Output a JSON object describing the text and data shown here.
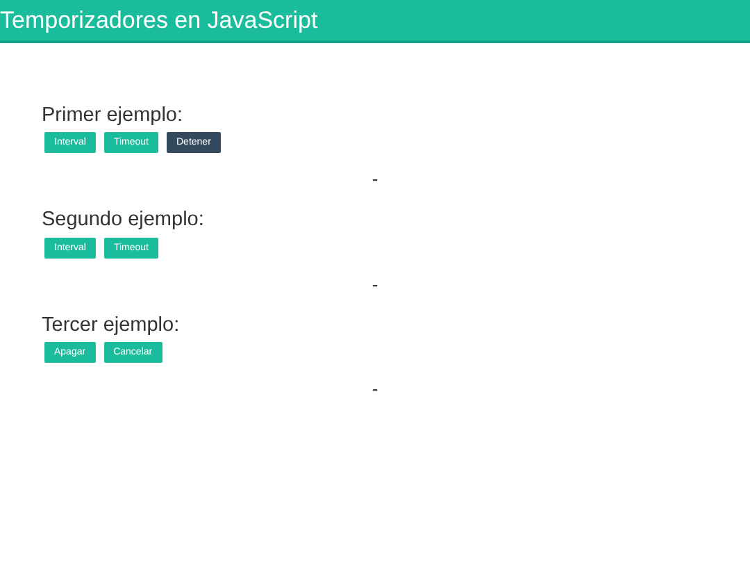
{
  "header": {
    "title": "Temporizadores en JavaScript"
  },
  "sections": [
    {
      "heading": "Primer ejemplo:",
      "buttons": [
        {
          "label": "Interval",
          "kind": "primary"
        },
        {
          "label": "Timeout",
          "kind": "primary"
        },
        {
          "label": "Detener",
          "kind": "dark"
        }
      ],
      "output": "-"
    },
    {
      "heading": "Segundo ejemplo:",
      "buttons": [
        {
          "label": "Interval",
          "kind": "primary"
        },
        {
          "label": "Timeout",
          "kind": "primary"
        }
      ],
      "output": "-"
    },
    {
      "heading": "Tercer ejemplo:",
      "buttons": [
        {
          "label": "Apagar",
          "kind": "primary"
        },
        {
          "label": "Cancelar",
          "kind": "primary"
        }
      ],
      "output": "-"
    }
  ]
}
